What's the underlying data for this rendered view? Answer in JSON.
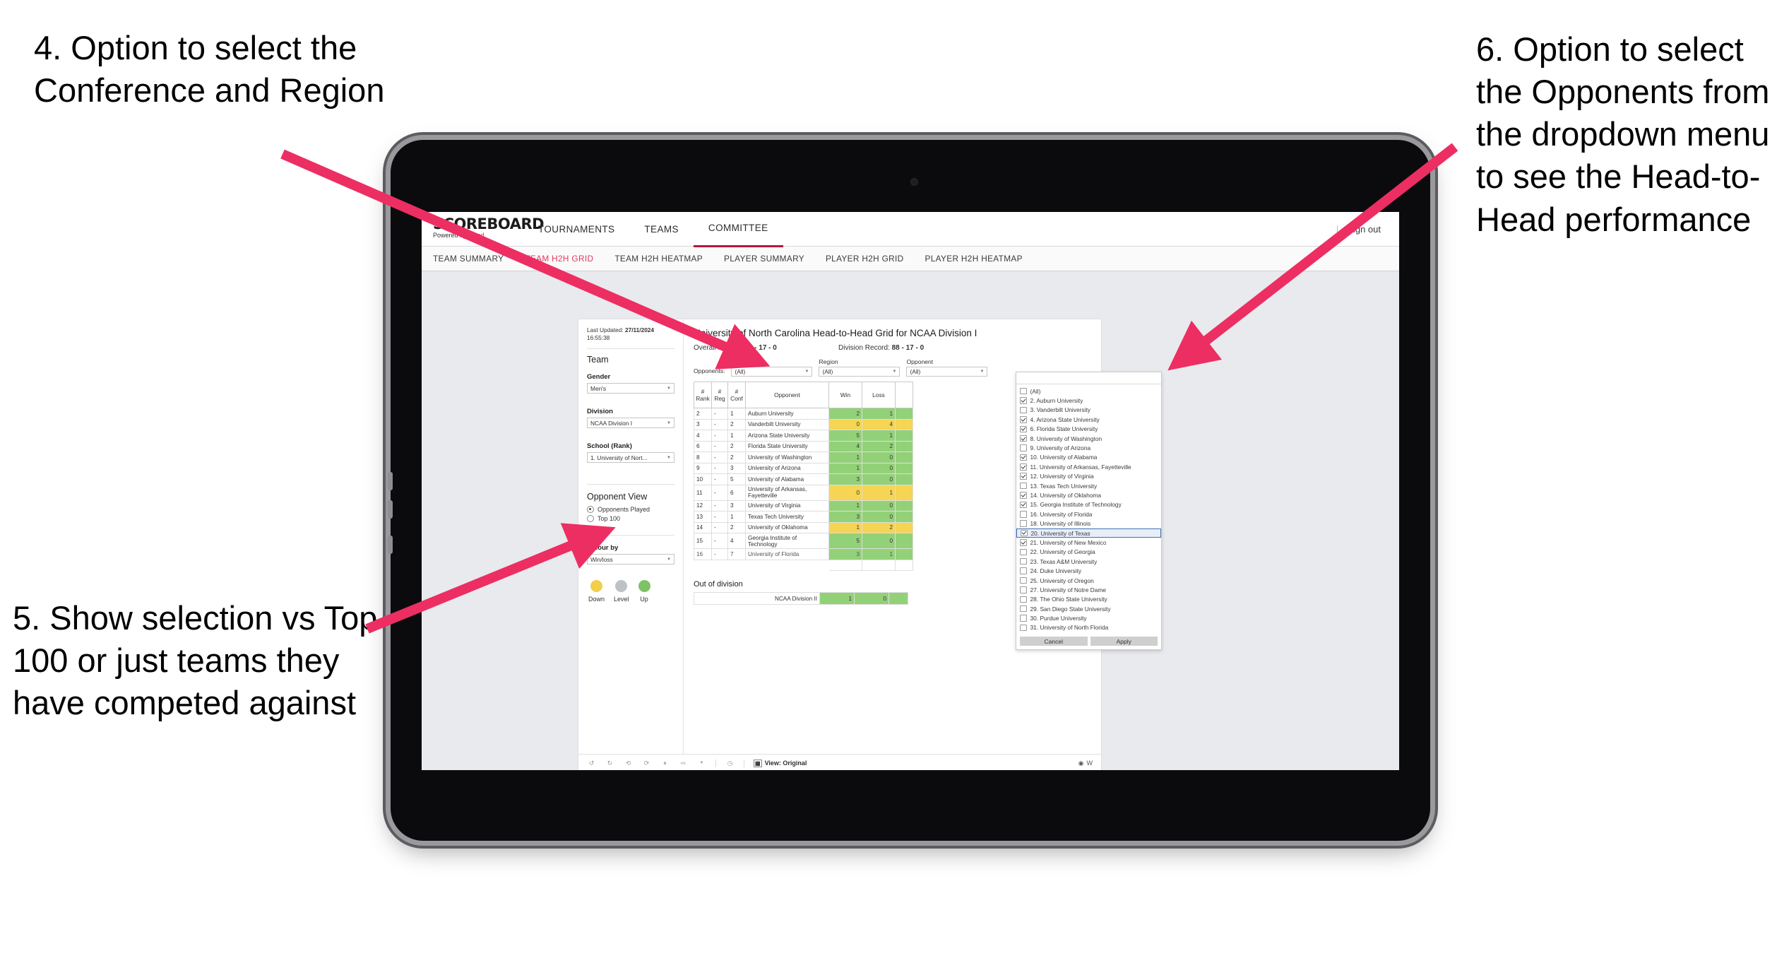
{
  "annotations": [
    {
      "id": "4",
      "text": "4. Option to select the Conference and Region"
    },
    {
      "id": "5",
      "text": "5. Show selection vs Top 100 or just teams they have competed against"
    },
    {
      "id": "6",
      "text": "6. Option to select the Opponents from the dropdown menu to see the Head-to-Head performance"
    }
  ],
  "accent_pink": "#ED2E63",
  "header": {
    "logo": "SCOREBOARD",
    "logo_sub_prefix": "Powered by ",
    "logo_sub_brand": "Flood",
    "nav": [
      {
        "label": "TOURNAMENTS",
        "active": false
      },
      {
        "label": "TEAMS",
        "active": false
      },
      {
        "label": "COMMITTEE",
        "active": true
      }
    ],
    "divider": "|",
    "signout": "Sign out"
  },
  "subnav": [
    {
      "label": "TEAM SUMMARY",
      "active": false
    },
    {
      "label": "TEAM H2H GRID",
      "active": true
    },
    {
      "label": "TEAM H2H HEATMAP",
      "active": false
    },
    {
      "label": "PLAYER SUMMARY",
      "active": false
    },
    {
      "label": "PLAYER H2H GRID",
      "active": false
    },
    {
      "label": "PLAYER H2H HEATMAP",
      "active": false
    }
  ],
  "sidebar": {
    "last_updated_label": "Last Updated: ",
    "last_updated_value": "27/11/2024",
    "last_updated_time": "16:55:38",
    "team_heading": "Team",
    "gender_label": "Gender",
    "gender_value": "Men's",
    "division_label": "Division",
    "division_value": "NCAA Division I",
    "school_label": "School (Rank)",
    "school_value": "1. University of Nort...",
    "opponent_view_heading": "Opponent View",
    "opponent_view_options": [
      {
        "label": "Opponents Played",
        "selected": true
      },
      {
        "label": "Top 100",
        "selected": false
      }
    ],
    "colour_by_label": "Colour by",
    "colour_by_value": "Win/loss",
    "legend": [
      {
        "label": "Down",
        "color": "#F2CF4A"
      },
      {
        "label": "Level",
        "color": "#BFC2C4"
      },
      {
        "label": "Up",
        "color": "#7DC264"
      }
    ]
  },
  "main": {
    "title": "University of North Carolina Head-to-Head Grid for NCAA Division I",
    "overall_record_label": "Overall Record: ",
    "overall_record_value": "89 - 17 - 0",
    "division_record_label": "Division Record: ",
    "division_record_value": "88 - 17 - 0",
    "opponents_prefix": "Opponents:",
    "filters": [
      {
        "label": "Conference",
        "value": "(All)"
      },
      {
        "label": "Region",
        "value": "(All)"
      },
      {
        "label": "Opponent",
        "value": "(All)"
      }
    ],
    "table_headers": {
      "rank": "#\nRank",
      "reg": "#\nReg",
      "conf": "#\nConf",
      "opponent": "Opponent",
      "win": "Win",
      "loss": "Loss"
    },
    "rows": [
      {
        "rank": "2",
        "reg": "-",
        "conf": "1",
        "opponent": "Auburn University",
        "win": "2",
        "loss": "1",
        "color": "green"
      },
      {
        "rank": "3",
        "reg": "-",
        "conf": "2",
        "opponent": "Vanderbilt University",
        "win": "0",
        "loss": "4",
        "color": "yellow"
      },
      {
        "rank": "4",
        "reg": "-",
        "conf": "1",
        "opponent": "Arizona State University",
        "win": "5",
        "loss": "1",
        "color": "green"
      },
      {
        "rank": "6",
        "reg": "-",
        "conf": "2",
        "opponent": "Florida State University",
        "win": "4",
        "loss": "2",
        "color": "green"
      },
      {
        "rank": "8",
        "reg": "-",
        "conf": "2",
        "opponent": "University of Washington",
        "win": "1",
        "loss": "0",
        "color": "green"
      },
      {
        "rank": "9",
        "reg": "-",
        "conf": "3",
        "opponent": "University of Arizona",
        "win": "1",
        "loss": "0",
        "color": "green"
      },
      {
        "rank": "10",
        "reg": "-",
        "conf": "5",
        "opponent": "University of Alabama",
        "win": "3",
        "loss": "0",
        "color": "green"
      },
      {
        "rank": "11",
        "reg": "-",
        "conf": "6",
        "opponent": "University of Arkansas, Fayetteville",
        "win": "0",
        "loss": "1",
        "color": "yellow"
      },
      {
        "rank": "12",
        "reg": "-",
        "conf": "3",
        "opponent": "University of Virginia",
        "win": "1",
        "loss": "0",
        "color": "green"
      },
      {
        "rank": "13",
        "reg": "-",
        "conf": "1",
        "opponent": "Texas Tech University",
        "win": "3",
        "loss": "0",
        "color": "green"
      },
      {
        "rank": "14",
        "reg": "-",
        "conf": "2",
        "opponent": "University of Oklahoma",
        "win": "1",
        "loss": "2",
        "color": "yellow"
      },
      {
        "rank": "15",
        "reg": "-",
        "conf": "4",
        "opponent": "Georgia Institute of Technology",
        "win": "5",
        "loss": "0",
        "color": "green"
      },
      {
        "rank": "16",
        "reg": "-",
        "conf": "7",
        "opponent": "University of Florida",
        "win": "3",
        "loss": "1",
        "color": "green"
      }
    ],
    "out_of_division_title": "Out of division",
    "out_of_division_rows": [
      {
        "name": "NCAA Division II",
        "win": "1",
        "loss": "0",
        "color": "green"
      }
    ]
  },
  "opponent_popup": {
    "options": [
      {
        "label": "(All)",
        "checked": false,
        "highlighted": false
      },
      {
        "label": "2. Auburn University",
        "checked": true,
        "highlighted": false
      },
      {
        "label": "3. Vanderbilt University",
        "checked": false,
        "highlighted": false
      },
      {
        "label": "4. Arizona State University",
        "checked": true,
        "highlighted": false
      },
      {
        "label": "6. Florida State University",
        "checked": true,
        "highlighted": false
      },
      {
        "label": "8. University of Washington",
        "checked": true,
        "highlighted": false
      },
      {
        "label": "9. University of Arizona",
        "checked": false,
        "highlighted": false
      },
      {
        "label": "10. University of Alabama",
        "checked": true,
        "highlighted": false
      },
      {
        "label": "11. University of Arkansas, Fayetteville",
        "checked": true,
        "highlighted": false
      },
      {
        "label": "12. University of Virginia",
        "checked": true,
        "highlighted": false
      },
      {
        "label": "13. Texas Tech University",
        "checked": false,
        "highlighted": false
      },
      {
        "label": "14. University of Oklahoma",
        "checked": true,
        "highlighted": false
      },
      {
        "label": "15. Georgia Institute of Technology",
        "checked": true,
        "highlighted": false
      },
      {
        "label": "16. University of Florida",
        "checked": false,
        "highlighted": false
      },
      {
        "label": "18. University of Illinois",
        "checked": false,
        "highlighted": false
      },
      {
        "label": "20. University of Texas",
        "checked": true,
        "highlighted": true
      },
      {
        "label": "21. University of New Mexico",
        "checked": true,
        "highlighted": false
      },
      {
        "label": "22. University of Georgia",
        "checked": false,
        "highlighted": false
      },
      {
        "label": "23. Texas A&M University",
        "checked": false,
        "highlighted": false
      },
      {
        "label": "24. Duke University",
        "checked": false,
        "highlighted": false
      },
      {
        "label": "25. University of Oregon",
        "checked": false,
        "highlighted": false
      },
      {
        "label": "27. University of Notre Dame",
        "checked": false,
        "highlighted": false
      },
      {
        "label": "28. The Ohio State University",
        "checked": false,
        "highlighted": false
      },
      {
        "label": "29. San Diego State University",
        "checked": false,
        "highlighted": false
      },
      {
        "label": "30. Purdue University",
        "checked": false,
        "highlighted": false
      },
      {
        "label": "31. University of North Florida",
        "checked": false,
        "highlighted": false
      }
    ],
    "cancel": "Cancel",
    "apply": "Apply"
  },
  "toolbar": {
    "icons": [
      "undo-icon",
      "redo-icon",
      "revert-icon",
      "refresh-icon",
      "pause-icon",
      "share-icon",
      "chevron-down-icon",
      "history-icon"
    ],
    "view_label": "View: Original",
    "watch_label": "W"
  }
}
